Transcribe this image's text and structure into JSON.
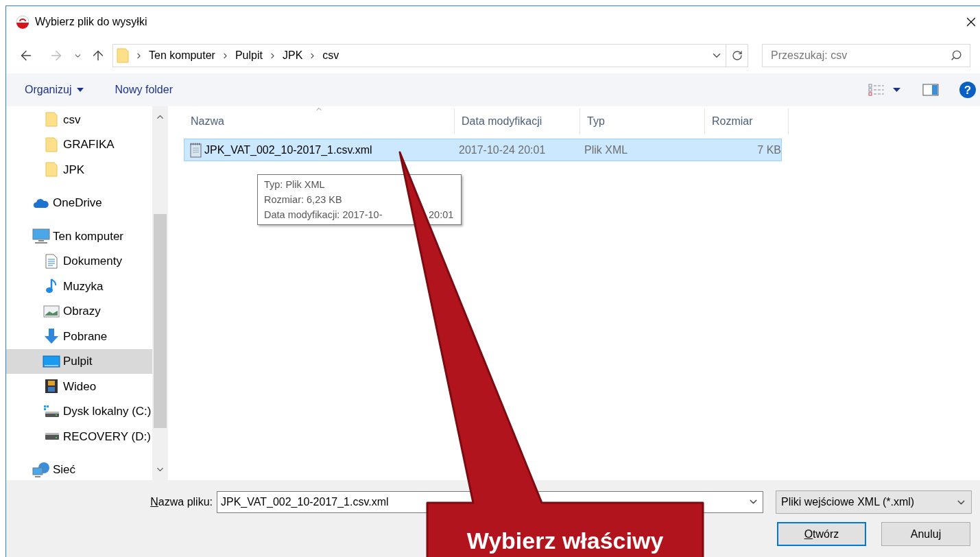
{
  "window": {
    "title": "Wybierz plik do wysyłki"
  },
  "address_bar": {
    "path": [
      "Ten komputer",
      "Pulpit",
      "JPK",
      "csv"
    ]
  },
  "search": {
    "placeholder": "Przeszukaj: csv"
  },
  "toolbar": {
    "organize": "Organizuj",
    "new_folder": "Nowy folder",
    "help": "?"
  },
  "sidebar": {
    "pinned_folders": [
      {
        "label": "csv",
        "kind": "folder",
        "selected": false
      },
      {
        "label": "GRAFIKA",
        "kind": "folder",
        "selected": false
      },
      {
        "label": "JPK",
        "kind": "folder",
        "selected": false
      }
    ],
    "items": [
      {
        "label": "OneDrive",
        "kind": "cloud",
        "selected": false
      },
      {
        "label": "Ten komputer",
        "kind": "computer",
        "selected": false,
        "children": [
          {
            "label": "Dokumenty",
            "kind": "documents",
            "selected": false
          },
          {
            "label": "Muzyka",
            "kind": "music",
            "selected": false
          },
          {
            "label": "Obrazy",
            "kind": "pictures",
            "selected": false
          },
          {
            "label": "Pobrane",
            "kind": "downloads",
            "selected": false
          },
          {
            "label": "Pulpit",
            "kind": "desktop",
            "selected": true
          },
          {
            "label": "Wideo",
            "kind": "video",
            "selected": false
          },
          {
            "label": "Dysk lokalny (C:)",
            "kind": "system-drive",
            "selected": false
          },
          {
            "label": "RECOVERY (D:)",
            "kind": "drive",
            "selected": false
          }
        ]
      },
      {
        "label": "Sieć",
        "kind": "network",
        "selected": false
      }
    ]
  },
  "table": {
    "columns": [
      "Nazwa",
      "Data modyfikacji",
      "Typ",
      "Rozmiar"
    ],
    "rows": [
      {
        "name": "JPK_VAT_002_10-2017_1.csv.xml",
        "modified": "2017-10-24 20:01",
        "type": "Plik XML",
        "size": "7 KB",
        "selected": true
      }
    ]
  },
  "tooltip": {
    "lines": [
      [
        "Typ: Plik XML"
      ],
      [
        "Rozmiar: 6,23 KB"
      ],
      [
        "Data modyfikacji: 2017-10-",
        "20:01"
      ]
    ]
  },
  "file_name": {
    "label": "Nazwa pliku:",
    "mnemonic": true,
    "value": "JPK_VAT_002_10-2017_1.csv.xml"
  },
  "file_type": {
    "value": "Pliki wejściowe XML (*.xml)"
  },
  "buttons": [
    {
      "label": "Otwórz",
      "mnemonic": true,
      "default": true
    },
    {
      "label": "Anuluj",
      "mnemonic": false,
      "default": false
    }
  ],
  "callout": {
    "text": "Wybierz właściwy"
  }
}
